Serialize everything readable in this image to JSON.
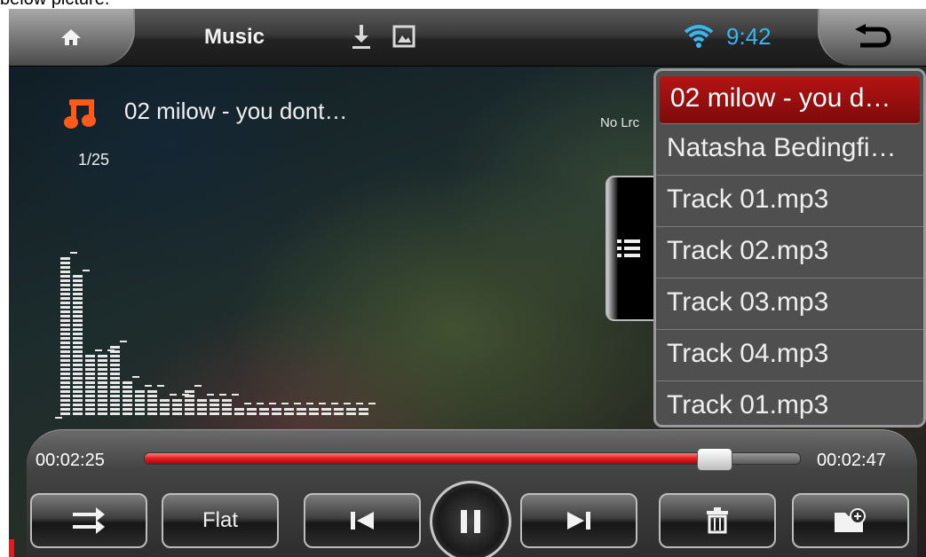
{
  "caption": "below picture.",
  "status": {
    "title": "Music",
    "time": "9:42",
    "icons": [
      "home-icon",
      "download-icon",
      "image-icon",
      "wifi-icon",
      "back-icon"
    ]
  },
  "track": {
    "title": "02 milow - you dont…",
    "index": "1/25",
    "lyrics_status": "No Lrc"
  },
  "playlist": {
    "items": [
      {
        "label": "02 milow - you d…",
        "active": true
      },
      {
        "label": "Natasha Bedingfi…",
        "active": false
      },
      {
        "label": "Track 01.mp3",
        "active": false
      },
      {
        "label": "Track 02.mp3",
        "active": false
      },
      {
        "label": "Track 03.mp3",
        "active": false
      },
      {
        "label": "Track 04.mp3",
        "active": false
      },
      {
        "label": "Track 01.mp3",
        "active": false
      }
    ]
  },
  "progress": {
    "current": "00:02:25",
    "total": "00:02:47",
    "fraction": 0.868
  },
  "spectrum_levels": [
    18,
    16,
    7,
    7,
    8,
    4,
    3,
    3,
    2,
    2,
    3,
    2,
    2,
    2,
    1,
    1,
    1,
    1,
    1,
    1,
    1,
    1,
    1,
    1,
    1
  ],
  "controls": {
    "eq_label": "Flat",
    "buttons": [
      "repeat-icon",
      "previous-icon",
      "pause-icon",
      "next-icon",
      "delete-icon",
      "add-to-folder-icon"
    ]
  },
  "colors": {
    "accent_red": "#e21d1d",
    "clock_blue": "#39b7f0",
    "note_orange": "#ff5a1a"
  }
}
